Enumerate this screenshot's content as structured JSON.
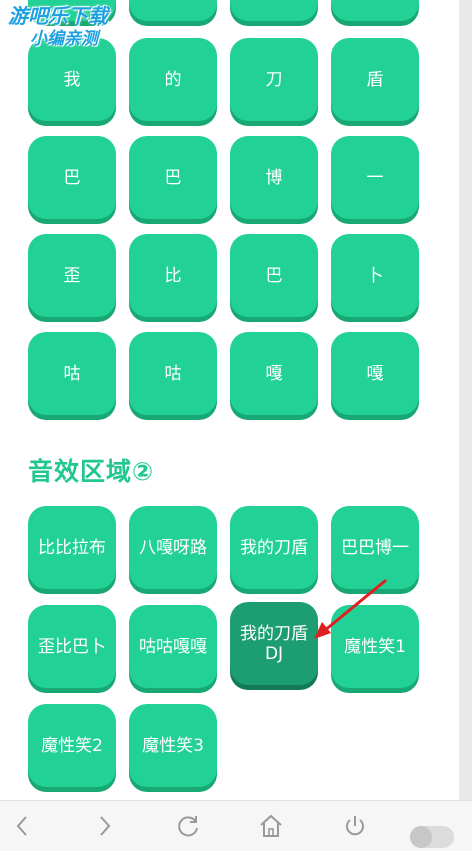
{
  "watermark": {
    "line1": "游吧乐下载",
    "line2": "小编亲测"
  },
  "section2": {
    "title": "音效区域②"
  },
  "grid1": [
    "我",
    "的",
    "刀",
    "盾",
    "巴",
    "巴",
    "博",
    "一",
    "歪",
    "比",
    "巴",
    "卜",
    "咕",
    "咕",
    "嘎",
    "嘎"
  ],
  "grid2": [
    "比比拉布",
    "八嘎呀路",
    "我的刀盾",
    "巴巴博一",
    "歪比巴卜",
    "咕咕嘎嘎",
    "我的刀盾DJ",
    "魔性笑1",
    "魔性笑2",
    "魔性笑3"
  ],
  "annotation": {
    "color": "#e02020"
  },
  "browser_nav": {
    "icons": [
      "back-icon",
      "forward-icon",
      "refresh-icon",
      "home-icon",
      "power-icon",
      "toggle-switch"
    ]
  },
  "colors": {
    "button": "#22d195",
    "button_pressed": "#1c9e72",
    "title": "#22c78f"
  }
}
